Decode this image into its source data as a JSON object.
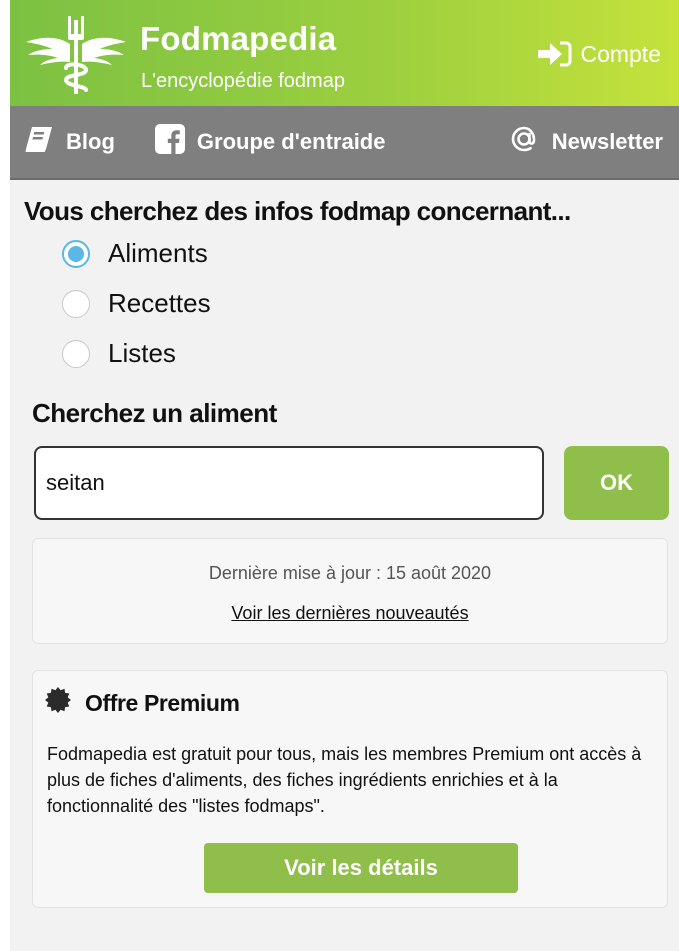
{
  "header": {
    "title": "Fodmapedia",
    "subtitle": "L'encyclopédie fodmap",
    "account_label": "Compte"
  },
  "nav": {
    "blog": "Blog",
    "group": "Groupe d'entraide",
    "newsletter": "Newsletter"
  },
  "search": {
    "question": "Vous cherchez des infos fodmap concernant...",
    "options": [
      {
        "label": "Aliments",
        "checked": true
      },
      {
        "label": "Recettes",
        "checked": false
      },
      {
        "label": "Listes",
        "checked": false
      }
    ],
    "title": "Cherchez un aliment",
    "value": "seitan",
    "button": "OK"
  },
  "update": {
    "text": "Dernière mise à jour : 15 août 2020",
    "link": "Voir les dernières nouveautés"
  },
  "premium": {
    "title": "Offre Premium",
    "description": "Fodmapedia est gratuit pour tous, mais les membres Premium ont accès à plus de fiches d'aliments, des fiches ingrédients enrichies et à la fonctionnalité des \"listes fodmaps\".",
    "button": "Voir les détails"
  },
  "colors": {
    "header_start": "#7cc142",
    "header_end": "#c5e23b",
    "nav_bg": "#7f7f7f",
    "accent_green": "#8fbf4a",
    "radio_blue": "#5ab8e6"
  },
  "icons": {
    "logo": "caduceus-wings-icon",
    "account": "login-arrow-icon",
    "blog": "book-icon",
    "group": "facebook-icon",
    "newsletter": "at-sign-icon",
    "premium": "seal-badge-icon"
  }
}
